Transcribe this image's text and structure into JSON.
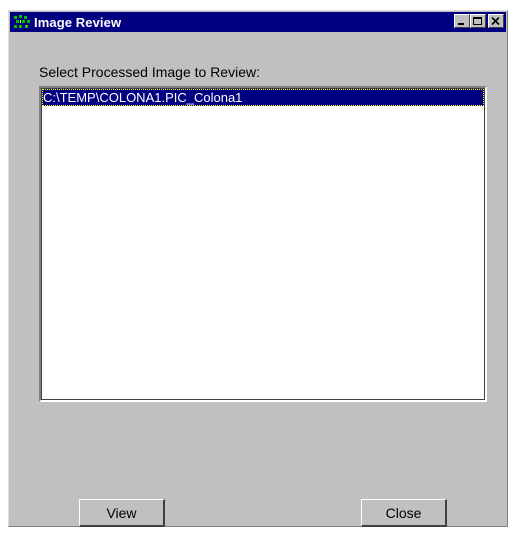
{
  "window": {
    "title": "Image Review",
    "icon": "app-grid-icon",
    "controls": [
      "minimize-icon",
      "maximize-icon",
      "close-icon"
    ]
  },
  "prompt_label": "Select Processed Image to Review:",
  "list": {
    "items": [
      {
        "label": "C:\\TEMP\\COLONA1.PIC_Colona1",
        "selected": true
      }
    ]
  },
  "buttons": {
    "view_label": "View",
    "close_label": "Close"
  },
  "colors": {
    "titlebar": "#000080",
    "face": "#c0c0c0",
    "selection": "#000080"
  }
}
